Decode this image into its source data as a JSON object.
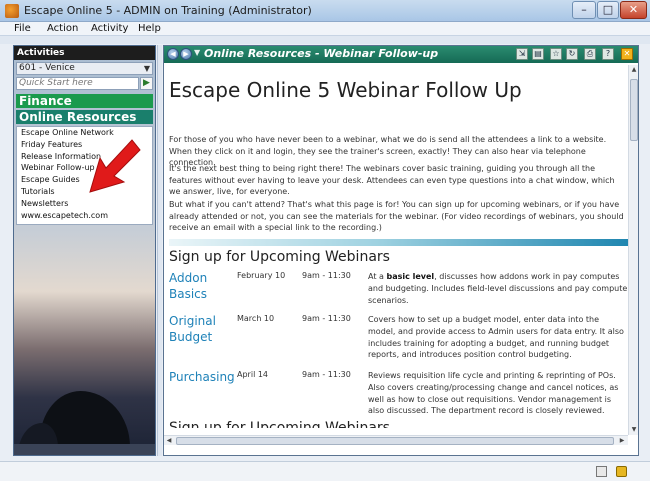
{
  "window": {
    "title": "Escape Online 5 - ADMIN on Training (Administrator)",
    "minimize": "–",
    "maximize": "□",
    "close": "✕"
  },
  "menu": [
    "File",
    "Action",
    "Activity",
    "Help"
  ],
  "sidebar": {
    "header": "Activities",
    "site": "601 - Venice",
    "quick_start_placeholder": "Quick Start here",
    "quick_start_go": "▶",
    "sections": [
      "Finance",
      "Online Resources"
    ],
    "resources": [
      "Escape Online Network",
      "Friday Features",
      "Release Information",
      "Webinar Follow-up",
      "Escape Guides",
      "Tutorials",
      "Newsletters",
      "www.escapetech.com"
    ]
  },
  "content": {
    "header_title": "Online Resources - Webinar Follow-up",
    "doc_title": "Escape Online 5 Webinar Follow Up",
    "paragraphs": [
      "For those of you who have never been to a webinar, what we do is send all the attendees a link to a website. When they click on it and login, they see the trainer's screen, exactly! They can also hear via telephone connection.",
      "It's the next best thing to being right there! The webinars cover basic training, guiding you through all the features without ever having to leave your desk. Attendees can even type questions into a chat window, which we answer, live, for everyone.",
      "But what if you can't attend? That's what this page is for! You can sign up for upcoming webinars, or if you have already attended or not, you can see the materials for the webinar. (For video recordings of webinars, you should receive an email with a special link to the recording.)"
    ],
    "signup_title": "Sign up for Upcoming Webinars",
    "webinars": [
      {
        "title": "Addon Basics",
        "date": "February 10",
        "time": "9am - 11:30",
        "desc_prefix": "At a ",
        "desc_bold": "basic level",
        "desc_rest": ", discusses how addons work in pay computes and budgeting. Includes field-level discussions and pay compute scenarios."
      },
      {
        "title": "Original Budget",
        "date": "March 10",
        "time": "9am - 11:30",
        "desc": "Covers how to set up a budget model, enter data into the model, and provide access to Admin users for data entry. It also includes training for adopting a budget, and running budget reports, and introduces position control budgeting."
      },
      {
        "title": "Purchasing",
        "date": "April 14",
        "time": "9am - 11:30",
        "desc": "Reviews requisition life cycle and printing & reprinting of POs. Also covers creating/processing change and cancel notices, as well as how to close out requisitions. Vendor management is also discussed. The department record is closely reviewed."
      }
    ],
    "signup_title_repeat": "Sign up for Upcoming Webinars"
  },
  "colors": {
    "header_green": "#1a7f6c",
    "finance_green": "#1b9a4d",
    "link_blue": "#1f82b8",
    "arrow_red": "#e01a1a"
  }
}
